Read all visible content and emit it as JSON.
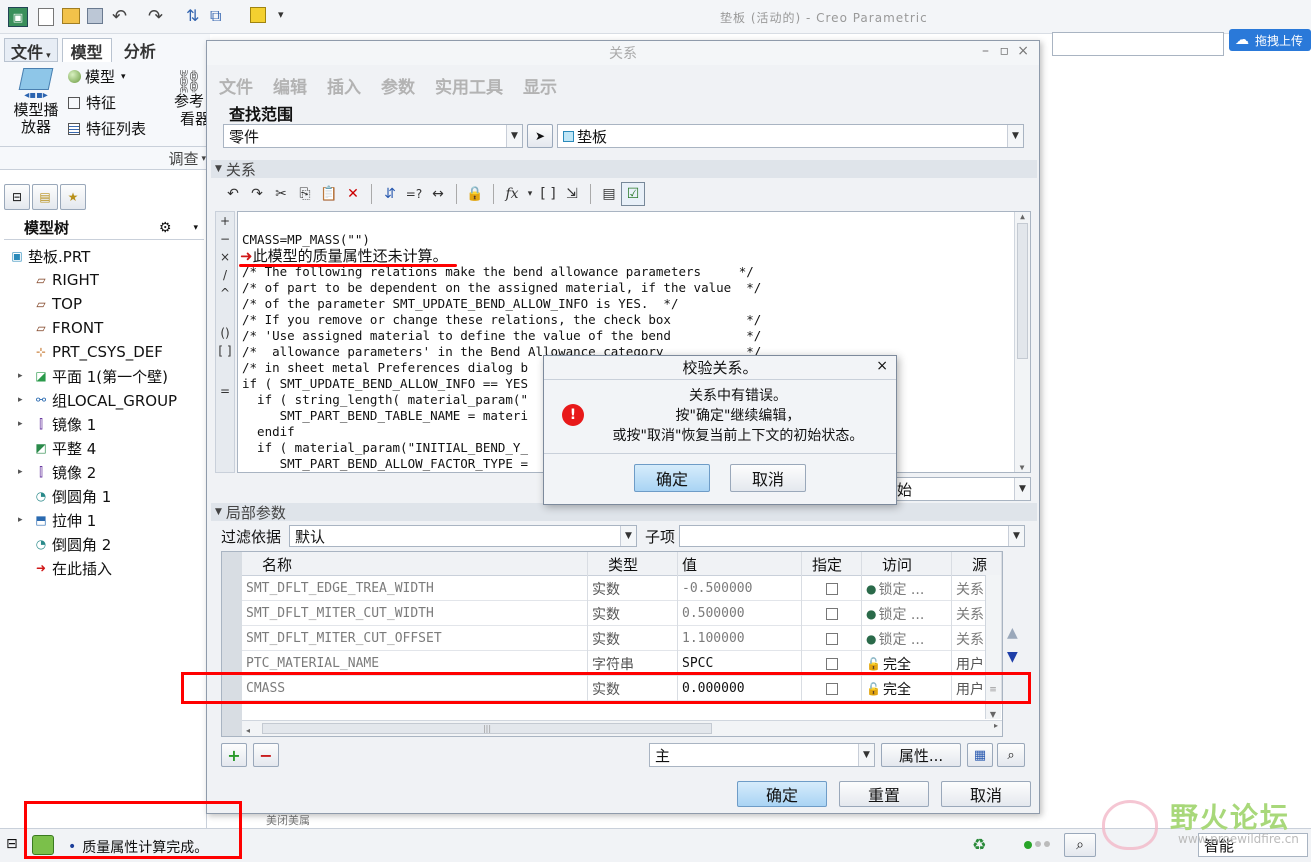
{
  "app": {
    "title": "垫板 (活动的) - Creo Parametric",
    "search_placeholder": "",
    "upload_label": "拖拽上传"
  },
  "ribbon": {
    "tabs": [
      "文件",
      "模型",
      "分析"
    ],
    "group_label_l1": "模型播",
    "group_label_l2": "放器",
    "model": "模型",
    "feature": "特征",
    "feature_list": "特征列表",
    "ref_l1": "参考",
    "ref_l2": "看器",
    "section": "调查"
  },
  "model_tree": {
    "title": "模型树",
    "items": [
      {
        "label": "垫板.PRT",
        "icon": "part-icon",
        "exp": ""
      },
      {
        "label": "RIGHT",
        "icon": "datum-plane-icon",
        "exp": ""
      },
      {
        "label": "TOP",
        "icon": "datum-plane-icon",
        "exp": ""
      },
      {
        "label": "FRONT",
        "icon": "datum-plane-icon",
        "exp": ""
      },
      {
        "label": "PRT_CSYS_DEF",
        "icon": "csys-icon",
        "exp": ""
      },
      {
        "label": "平面 1(第一个壁)",
        "icon": "wall-icon",
        "exp": "▸"
      },
      {
        "label": "组LOCAL_GROUP",
        "icon": "group-icon",
        "exp": "▸"
      },
      {
        "label": "镜像 1",
        "icon": "mirror-icon",
        "exp": "▸"
      },
      {
        "label": "平整 4",
        "icon": "flat-icon",
        "exp": ""
      },
      {
        "label": "镜像 2",
        "icon": "mirror-icon",
        "exp": "▸"
      },
      {
        "label": "倒圆角 1",
        "icon": "round-icon",
        "exp": ""
      },
      {
        "label": "拉伸 1",
        "icon": "extrude-icon",
        "exp": "▸"
      },
      {
        "label": "倒圆角 2",
        "icon": "round-icon",
        "exp": ""
      },
      {
        "label": "在此插入",
        "icon": "insert-arrow-icon",
        "exp": ""
      }
    ]
  },
  "relations_dialog": {
    "title": "关系",
    "menu": [
      "文件",
      "编辑",
      "插入",
      "参数",
      "实用工具",
      "显示"
    ],
    "lookup_label": "查找范围",
    "scope_value": "零件",
    "part_value": "垫板",
    "relations_section": "关系",
    "code_lines": [
      "CMASS=MP_MASS(\"\")",
      "此模型的质量属性还未计算。",
      "/* The following relations make the bend allowance parameters     */",
      "/* of part to be dependent on the assigned material, if the value  */",
      "/* of the parameter SMT_UPDATE_BEND_ALLOW_INFO is YES.  */",
      "/* If you remove or change these relations, the check box          */",
      "/* 'Use assigned material to define the value of the bend          */",
      "/*  allowance parameters' in the Bend Allowance category           */",
      "/* in sheet metal Preferences dialog b",
      "if ( SMT_UPDATE_BEND_ALLOW_INFO == YES",
      "  if ( string_length( material_param(\"",
      "     SMT_PART_BEND_TABLE_NAME = materi",
      "  endif",
      "  if ( material_param(\"INITIAL_BEND_Y_",
      "     SMT_PART_BEND_ALLOW_FACTOR_TYPE ="
    ],
    "hidden_combo_value": "始",
    "local_params": "局部参数",
    "filter_label": "过滤依据",
    "filter_value": "默认",
    "child_label": "子项",
    "columns": [
      "名称",
      "类型",
      "值",
      "指定",
      "访问",
      "源"
    ],
    "rows": [
      {
        "name": "SMT_DFLT_EDGE_TREA_WIDTH",
        "type": "实数",
        "value": "-0.500000",
        "access": "锁定 ...",
        "source": "关系",
        "locked": true
      },
      {
        "name": "SMT_DFLT_MITER_CUT_WIDTH",
        "type": "实数",
        "value": "0.500000",
        "access": "锁定 ...",
        "source": "关系",
        "locked": true
      },
      {
        "name": "SMT_DFLT_MITER_CUT_OFFSET",
        "type": "实数",
        "value": "1.100000",
        "access": "锁定 ...",
        "source": "关系",
        "locked": true
      },
      {
        "name": "PTC_MATERIAL_NAME",
        "type": "字符串",
        "value": "SPCC",
        "access": "完全",
        "source": "用户",
        "locked": false
      },
      {
        "name": "CMASS",
        "type": "实数",
        "value": "0.000000",
        "access": "完全",
        "source": "用户",
        "locked": false
      }
    ],
    "main_combo": "主",
    "props_button": "属性...",
    "ok": "确定",
    "reset": "重置",
    "cancel": "取消"
  },
  "verify_dialog": {
    "title": "校验关系。",
    "line1": "关系中有错误。",
    "line2": "按\"确定\"继续编辑，",
    "line3": "或按\"取消\"恢复当前上下文的初始状态。",
    "ok": "确定",
    "cancel": "取消"
  },
  "status": {
    "message": "质量属性计算完成。",
    "behind_text": "美闭美属",
    "mode": "智能"
  },
  "watermark": {
    "title": "野火论坛",
    "url": "www.proewildfire.cn"
  },
  "colors": {
    "accent": "#2a6fd4",
    "error_red": "#e8191a",
    "annotation_red": "#ff0000",
    "ok_button": "#bfe0f8"
  }
}
